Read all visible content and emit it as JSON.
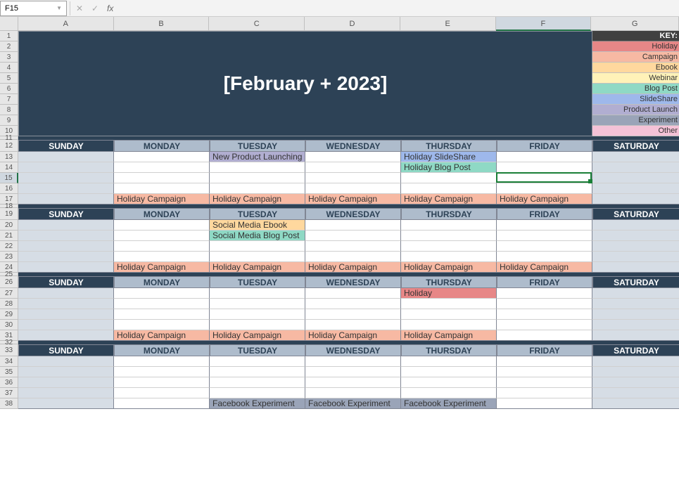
{
  "nameBox": "F15",
  "formula": "",
  "columns": [
    "A",
    "B",
    "C",
    "D",
    "E",
    "F",
    "G"
  ],
  "selectedCol": "F",
  "rowNums": [
    1,
    2,
    3,
    4,
    5,
    6,
    7,
    8,
    9,
    10,
    11,
    12,
    13,
    14,
    15,
    16,
    17,
    18,
    19,
    20,
    21,
    22,
    23,
    24,
    25,
    26,
    27,
    28,
    29,
    30,
    31,
    32,
    33,
    34,
    35,
    36,
    37,
    38
  ],
  "title": "[February + 2023]",
  "keyHeader": "KEY:",
  "key": [
    {
      "label": "Holiday",
      "cls": "c-holiday"
    },
    {
      "label": "Campaign",
      "cls": "c-campaign"
    },
    {
      "label": "Ebook",
      "cls": "c-ebook"
    },
    {
      "label": "Webinar",
      "cls": "c-webinar"
    },
    {
      "label": "Blog Post",
      "cls": "c-blogpost"
    },
    {
      "label": "SlideShare",
      "cls": "c-slideshare"
    },
    {
      "label": "Product Launch",
      "cls": "c-productlaunch"
    },
    {
      "label": "Experiment",
      "cls": "c-experiment"
    },
    {
      "label": "Other",
      "cls": "c-other"
    }
  ],
  "days": [
    "SUNDAY",
    "MONDAY",
    "TUESDAY",
    "WEDNESDAY",
    "THURSDAY",
    "FRIDAY",
    "SATURDAY"
  ],
  "events": {
    "w1": {
      "tue_r1": {
        "text": "New Product Launching",
        "cls": "c-productlaunch"
      },
      "thu_r1": {
        "text": "Holiday SlideShare",
        "cls": "c-slideshare"
      },
      "thu_r2": {
        "text": "Holiday Blog Post",
        "cls": "c-blogpost"
      },
      "mon_r5": {
        "text": "Holiday Campaign",
        "cls": "c-campaign"
      },
      "tue_r5": {
        "text": "Holiday Campaign",
        "cls": "c-campaign"
      },
      "wed_r5": {
        "text": "Holiday Campaign",
        "cls": "c-campaign"
      },
      "thu_r5": {
        "text": "Holiday Campaign",
        "cls": "c-campaign"
      },
      "fri_r5": {
        "text": "Holiday Campaign",
        "cls": "c-campaign"
      }
    },
    "w2": {
      "tue_r1": {
        "text": "Social Media Ebook",
        "cls": "c-ebook"
      },
      "tue_r2": {
        "text": "Social Media Blog Post",
        "cls": "c-blogpost"
      },
      "mon_r5": {
        "text": "Holiday Campaign",
        "cls": "c-campaign"
      },
      "tue_r5": {
        "text": "Holiday Campaign",
        "cls": "c-campaign"
      },
      "wed_r5": {
        "text": "Holiday Campaign",
        "cls": "c-campaign"
      },
      "thu_r5": {
        "text": "Holiday Campaign",
        "cls": "c-campaign"
      },
      "fri_r5": {
        "text": "Holiday Campaign",
        "cls": "c-campaign"
      }
    },
    "w3": {
      "thu_r1": {
        "text": "Holiday",
        "cls": "c-holiday"
      },
      "mon_r5": {
        "text": "Holiday Campaign",
        "cls": "c-campaign"
      },
      "tue_r5": {
        "text": "Holiday Campaign",
        "cls": "c-campaign"
      },
      "wed_r5": {
        "text": "Holiday Campaign",
        "cls": "c-campaign"
      },
      "thu_r5": {
        "text": "Holiday Campaign",
        "cls": "c-campaign"
      }
    },
    "w4": {
      "tue_r5": {
        "text": "Facebook Experiment",
        "cls": "c-experiment"
      },
      "wed_r5": {
        "text": "Facebook Experiment",
        "cls": "c-experiment"
      },
      "thu_r5": {
        "text": "Facebook Experiment",
        "cls": "c-experiment"
      }
    }
  }
}
